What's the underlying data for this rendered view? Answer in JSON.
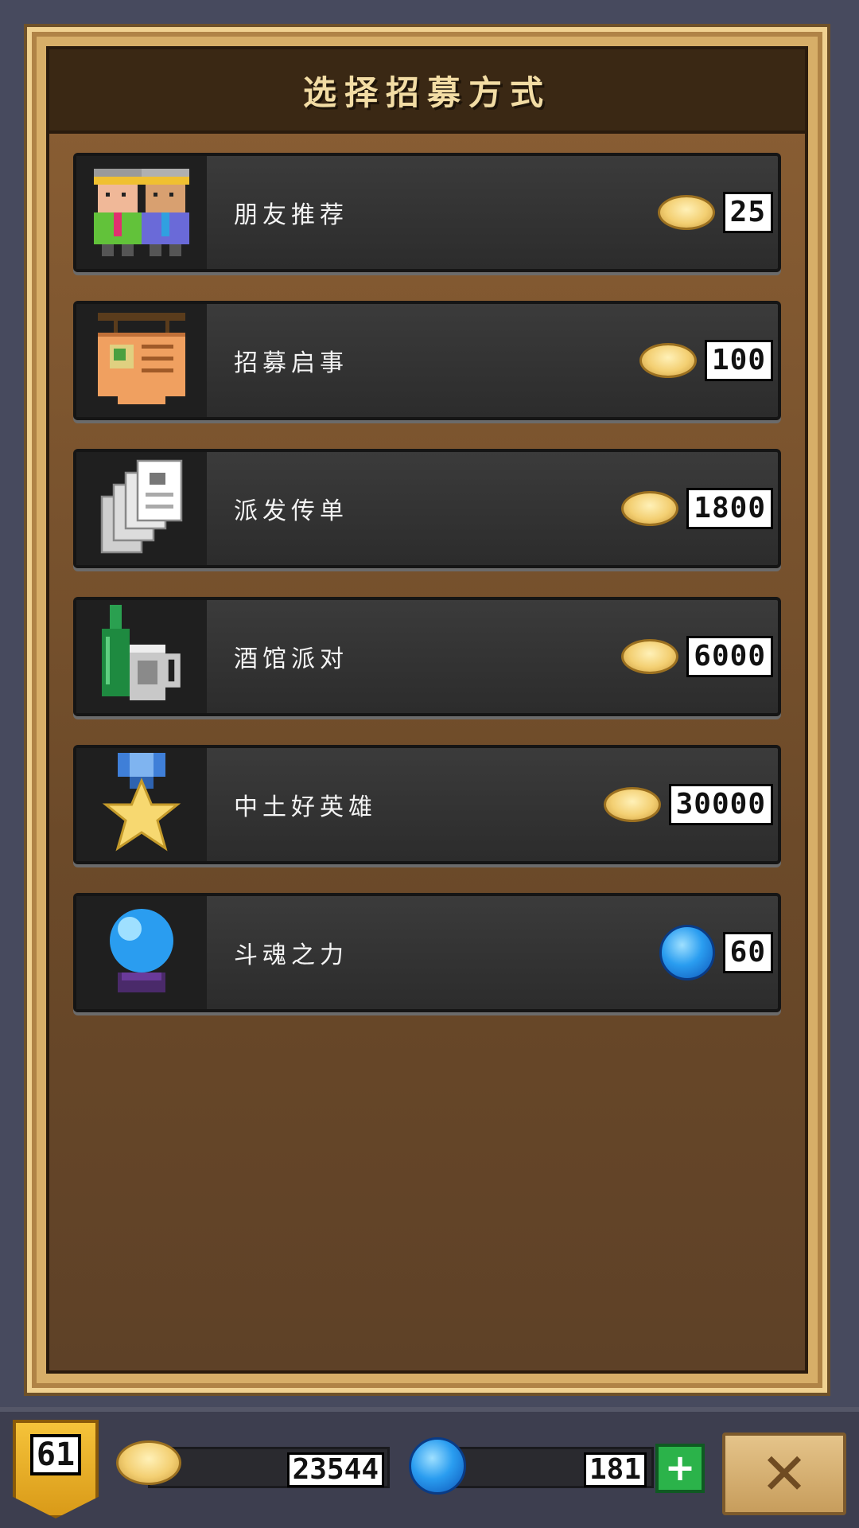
{
  "header": {
    "title": "选择招募方式"
  },
  "recruit_options": [
    {
      "label": "朋友推荐",
      "price": "25",
      "currency": "coin",
      "icon": "friends-icon"
    },
    {
      "label": "招募启事",
      "price": "100",
      "currency": "coin",
      "icon": "notice-board-icon"
    },
    {
      "label": "派发传单",
      "price": "1800",
      "currency": "coin",
      "icon": "flyers-icon"
    },
    {
      "label": "酒馆派对",
      "price": "6000",
      "currency": "coin",
      "icon": "tavern-drinks-icon"
    },
    {
      "label": "中土好英雄",
      "price": "30000",
      "currency": "coin",
      "icon": "medal-icon"
    },
    {
      "label": "斗魂之力",
      "price": "60",
      "currency": "gem",
      "icon": "crystal-ball-icon"
    }
  ],
  "bottom_bar": {
    "level": "61",
    "coins": "23544",
    "gems": "181",
    "add_label": "+",
    "close_label": "✕"
  },
  "colors": {
    "panel_frame": "#d7ae68",
    "panel_bg": "#6c4a29",
    "row_bg": "#333333",
    "title_text": "#f2dca4",
    "gem_blue": "#2a9df0",
    "coin_gold": "#f3cf72",
    "plus_green": "#2bb34a"
  }
}
